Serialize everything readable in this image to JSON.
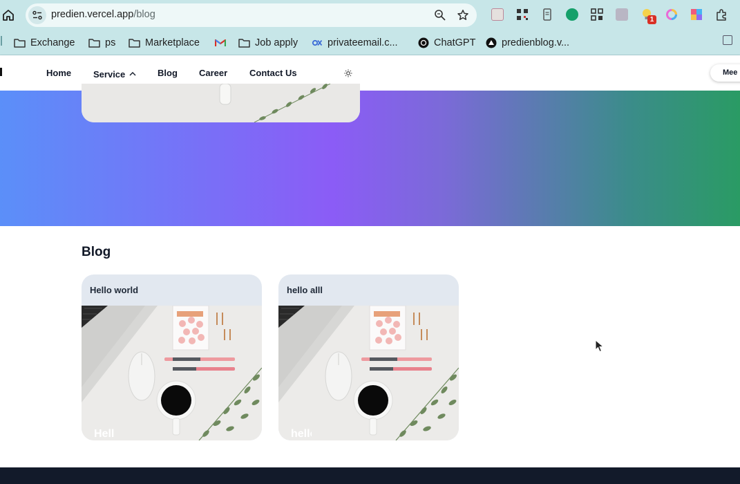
{
  "browser": {
    "url_domain": "predien.vercel.app",
    "url_path": "/blog",
    "extension_badge": "1",
    "bookmarks": [
      {
        "label": "Exchange",
        "icon": "folder-icon"
      },
      {
        "label": "ps",
        "icon": "folder-icon"
      },
      {
        "label": "Marketplace",
        "icon": "folder-icon"
      },
      {
        "label": "",
        "icon": "gmail-icon"
      },
      {
        "label": "Job apply",
        "icon": "folder-icon"
      },
      {
        "label": "privateemail.c...",
        "icon": "privateemail-icon"
      },
      {
        "label": "ChatGPT",
        "icon": "chatgpt-icon"
      },
      {
        "label": "predienblog.v...",
        "icon": "vercel-icon"
      }
    ]
  },
  "header": {
    "nav": [
      {
        "label": "Home"
      },
      {
        "label": "Service"
      },
      {
        "label": "Blog"
      },
      {
        "label": "Career"
      },
      {
        "label": "Contact Us"
      }
    ],
    "meet_button": "Mee"
  },
  "blog": {
    "heading": "Blog",
    "posts": [
      {
        "title": "Hello world",
        "overlay": "Hello world"
      },
      {
        "title": "hello alll",
        "overlay": "hello alll"
      }
    ]
  },
  "colors": {
    "chrome_bg": "#c7e6e8",
    "hero_start": "#5b8ff9",
    "hero_mid": "#8b5cf6",
    "hero_end": "#2a9b64",
    "card_bg": "#e2e8f0",
    "footer_bg": "#121a2a"
  }
}
